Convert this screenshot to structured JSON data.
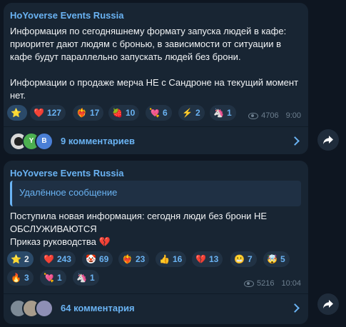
{
  "message1": {
    "channel": "HoYoverse Events Russia",
    "text": "Информация по сегодняшнему формату запуска людей в кафе: приоритет дают людям с бронью, в зависимости от ситуации в кафе будут параллельно запускать людей без брони.\n\nИнформации о продаже мерча НЕ с Сандроне на текущий момент нет.",
    "reactions": [
      {
        "emoji": "⭐",
        "count": ""
      },
      {
        "emoji": "❤️",
        "count": "127"
      },
      {
        "emoji": "❤️‍🔥",
        "count": "17"
      },
      {
        "emoji": "🍓",
        "count": "10"
      },
      {
        "emoji": "💘",
        "count": "6"
      },
      {
        "emoji": "⚡",
        "count": "2"
      },
      {
        "emoji": "🦄",
        "count": "1"
      }
    ],
    "views": "4706",
    "time": "9:00",
    "comments_label": "9 комментариев",
    "avatar_letters": [
      "",
      "Y",
      "B"
    ]
  },
  "message2": {
    "channel": "HoYoverse Events Russia",
    "quote": "Удалённое сообщение",
    "text": "Поступила новая информация: сегодня люди без брони НЕ ОБСЛУЖИВАЮТСЯ\nПриказ руководства 💔",
    "reactions": [
      {
        "emoji": "⭐",
        "count": "2"
      },
      {
        "emoji": "❤️",
        "count": "243"
      },
      {
        "emoji": "🤡",
        "count": "69"
      },
      {
        "emoji": "❤️‍🔥",
        "count": "23"
      },
      {
        "emoji": "👍",
        "count": "16"
      },
      {
        "emoji": "💔",
        "count": "13"
      },
      {
        "emoji": "😬",
        "count": "7"
      },
      {
        "emoji": "🤯",
        "count": "5"
      },
      {
        "emoji": "🔥",
        "count": "3"
      },
      {
        "emoji": "💘",
        "count": "1"
      },
      {
        "emoji": "🦄",
        "count": "1"
      }
    ],
    "views": "5216",
    "time": "10:04",
    "comments_label": "64 комментария"
  },
  "colors": {
    "background": "#0e1621",
    "bubble": "#182533",
    "accent": "#6ab3f3",
    "reaction_bg": "#213244",
    "meta": "#6d7f8f"
  }
}
